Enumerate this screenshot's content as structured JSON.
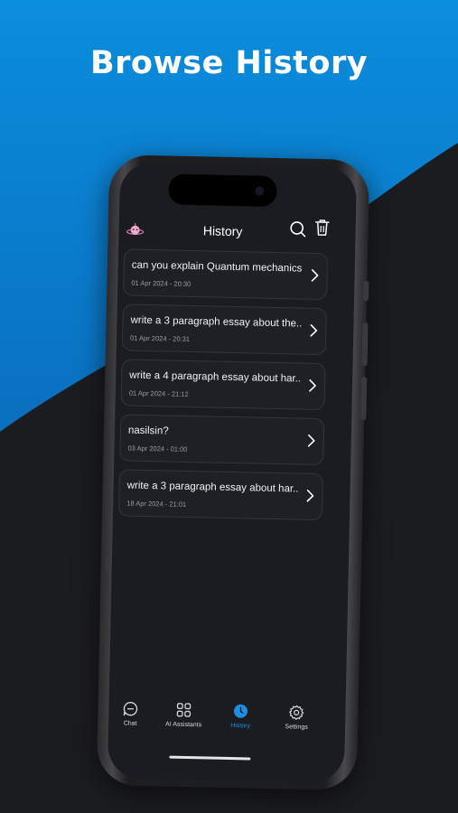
{
  "banner": {
    "headline": "Browse History"
  },
  "colors": {
    "accent": "#1e8fe0",
    "background": "#1b1c20",
    "banner_blue": "#0a82d4"
  },
  "app": {
    "title": "History",
    "logo_icon": "planet-robot-icon",
    "actions": [
      {
        "icon": "search-icon"
      },
      {
        "icon": "trash-icon"
      }
    ]
  },
  "history": [
    {
      "title": "can you explain Quantum mechanics l...",
      "date": "01 Apr 2024 - 20:30"
    },
    {
      "title": "write a 3 paragraph essay about the...",
      "date": "01 Apr 2024 - 20:31"
    },
    {
      "title": "write a 4 paragraph essay about har...",
      "date": "01 Apr 2024 - 21:12"
    },
    {
      "title": "nasilsin?",
      "date": "03 Apr 2024 - 01:00"
    },
    {
      "title": "write a 3 paragraph essay about har...",
      "date": "18 Apr 2024 - 21:01"
    }
  ],
  "tabs": [
    {
      "label": "Chat",
      "icon": "chat-bubble-icon",
      "active": false
    },
    {
      "label": "AI Assistants",
      "icon": "grid-icon",
      "active": false
    },
    {
      "label": "History",
      "icon": "clock-icon",
      "active": true
    },
    {
      "label": "Settings",
      "icon": "gear-icon",
      "active": false
    }
  ]
}
